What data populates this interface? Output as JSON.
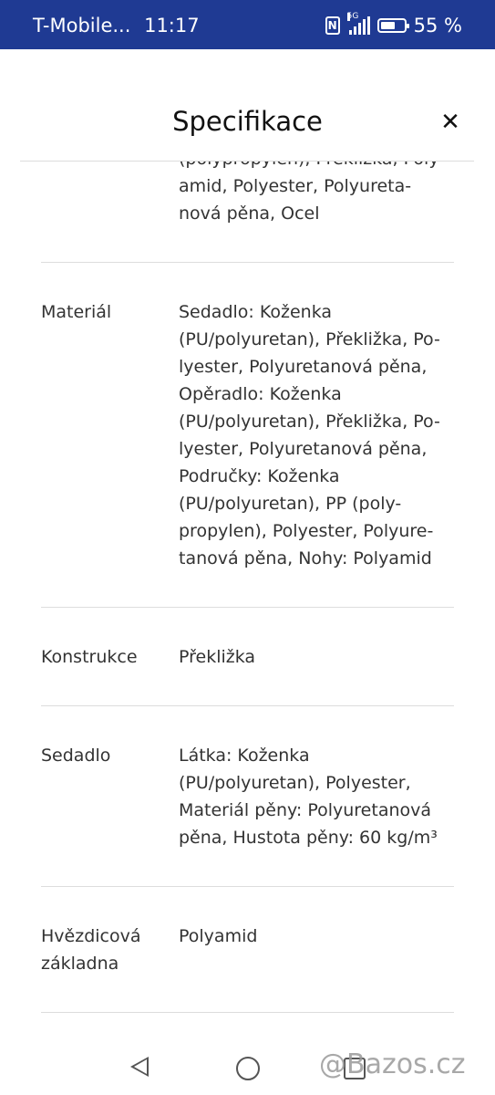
{
  "status_bar": {
    "carrier": "T-Mobile...",
    "time": "11:17",
    "network": "5G",
    "battery": "55 %"
  },
  "header": {
    "title": "Specifikace",
    "close_symbol": "✕"
  },
  "specs": [
    {
      "label": "",
      "value": "(polypropylen), Překližka, Poly-\namid, Polyester, Polyureta-\nnová pěna, Ocel"
    },
    {
      "label": "Materiál",
      "value": "Sedadlo: Koženka\n(PU/polyuretan), Překližka, Po-\nlyester, Polyuretanová pěna,\nOpěradlo: Koženka\n(PU/polyuretan), Překližka, Po-\nlyester, Polyuretanová pěna,\nPodručky: Koženka\n(PU/polyuretan), PP (poly-\npropylen), Polyester, Polyure-\ntanová pěna, Nohy: Polyamid"
    },
    {
      "label": "Konstrukce",
      "value": "Překližka"
    },
    {
      "label": "Sedadlo",
      "value": "Látka: Koženka\n(PU/polyuretan), Polyester,\nMateriál pěny: Polyuretanová\npěna, Hustota pěny: 60 kg/m³"
    },
    {
      "label": "Hvězdicová\nzákladna",
      "value": "Polyamid"
    }
  ],
  "watermark": "@Bazos.cz",
  "colors": {
    "status_bar": "#1f3a93",
    "divider": "#dddddd",
    "text": "#333333"
  }
}
